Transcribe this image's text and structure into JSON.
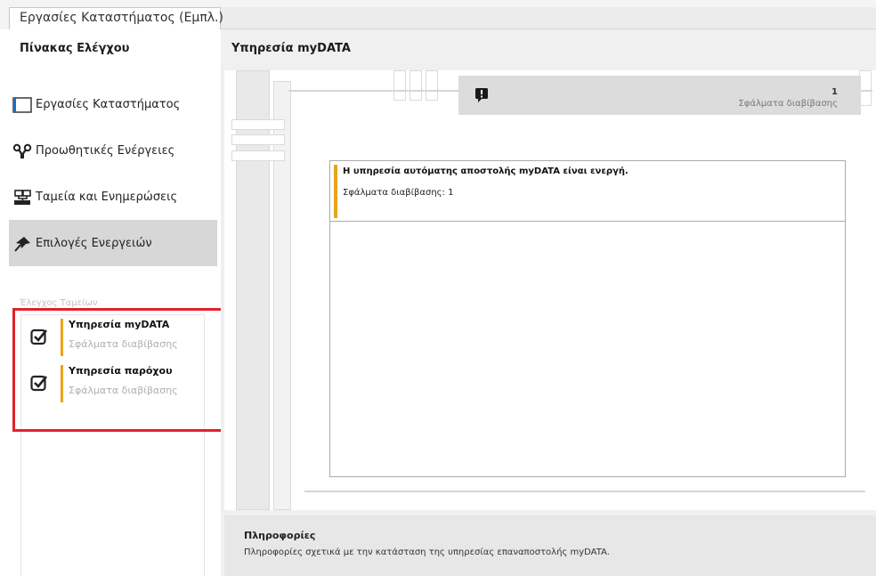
{
  "window": {
    "tab_label": "Εργασίες Καταστήματος (Εμπλ.)"
  },
  "sidebar": {
    "title": "Πίνακας Ελέγχου",
    "items": [
      {
        "label": "Εργασίες Καταστήματος",
        "icon": "window-icon"
      },
      {
        "label": "Προωθητικές Ενέργειες",
        "icon": "promotion-icon"
      },
      {
        "label": "Ταμεία και Ενημερώσεις",
        "icon": "network-icon"
      },
      {
        "label": "Επιλογές Ενεργειών",
        "icon": "pin-icon",
        "active": true
      }
    ],
    "group_label": "Έλεγχος Ταμείων",
    "status_items": [
      {
        "title": "Υπηρεσία myDATA",
        "subtitle": "Σφάλματα διαβίβασης",
        "icon": "checkbox-icon"
      },
      {
        "title": "Υπηρεσία παρόχου",
        "subtitle": "Σφάλματα διαβίβασης",
        "icon": "checkbox-icon"
      }
    ],
    "highlight_color": "#e3202a"
  },
  "main": {
    "title": "Υπηρεσία myDATA",
    "errors": {
      "count": "1",
      "label": "Σφάλματα διαβίβασης",
      "icon": "alert-icon"
    },
    "message": {
      "title": "Η υπηρεσία αυτόματης αποστολής myDATA είναι ενεργή.",
      "line": "Σφάλματα διαβίβασης: 1"
    },
    "info": {
      "title": "Πληροφορίες",
      "text": "Πληροφορίες σχετικά με την κατάσταση της υπηρεσίας επαναποστολής myDATA."
    }
  },
  "colors": {
    "accent": "#e8a41c",
    "active_nav": "#d7d7d7"
  }
}
